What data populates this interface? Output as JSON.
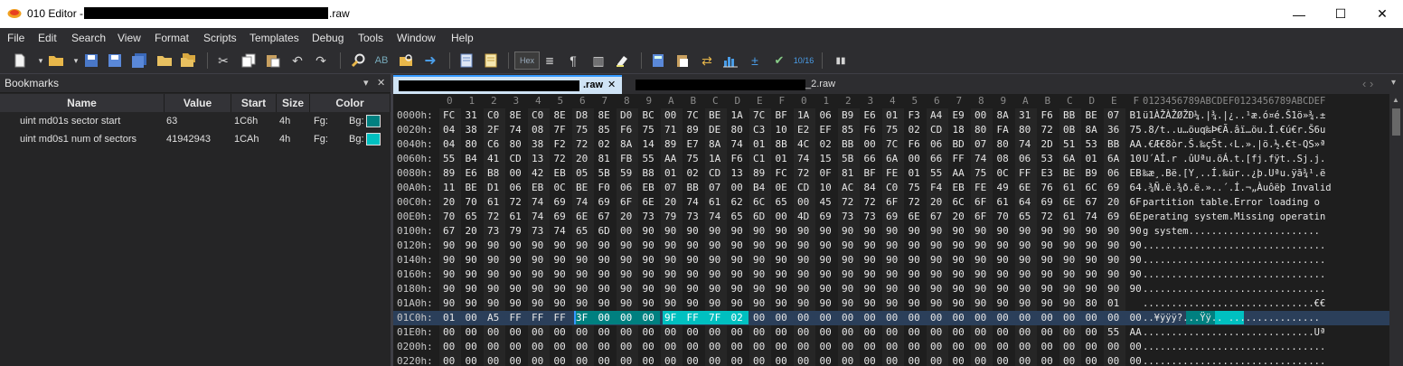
{
  "window": {
    "app_title": "010 Editor -",
    "file_suffix": ".raw",
    "min_symbol": "—",
    "max_symbol": "☐",
    "close_symbol": "✕"
  },
  "menu": [
    "File",
    "Edit",
    "Search",
    "View",
    "Format",
    "Scripts",
    "Templates",
    "Debug",
    "Tools",
    "Window",
    "Help"
  ],
  "toolbar": {
    "hex_label": "Hex",
    "icons": [
      "new-file-icon",
      "open-folder-icon",
      "save-icon",
      "save-as-icon",
      "save-all-icon",
      "open-folder-2-icon",
      "open-project-icon",
      "cut-icon",
      "copy-icon",
      "paste-icon",
      "undo-icon",
      "redo-icon",
      "find-icon",
      "replace-icon",
      "find-in-files-icon",
      "goto-icon",
      "run-script-icon",
      "run-template-icon",
      "hex-mode-icon",
      "text-mode-icon",
      "paragraph-icon",
      "columns-icon",
      "highlight-icon",
      "calculator-icon",
      "clipboard-icon",
      "compare-icon",
      "histogram-icon",
      "plus-minus-icon",
      "checksum-icon",
      "base-convert-icon",
      "pause-icon"
    ]
  },
  "bookmarks": {
    "title": "Bookmarks",
    "pin_symbol": "▾",
    "close_symbol": "✕",
    "columns": [
      "Name",
      "Value",
      "Start",
      "Size",
      "Color"
    ],
    "rows": [
      {
        "name": "uint md01s sector start",
        "value": "63",
        "start": "1C6h",
        "size": "4h",
        "fg": "Fg:",
        "bg": "Bg:",
        "bg_color": "#008080"
      },
      {
        "name": "uint md0s1 num of sectors",
        "value": "41942943",
        "start": "1CAh",
        "size": "4h",
        "fg": "Fg:",
        "bg": "Bg:",
        "bg_color": "#00c0c0"
      }
    ]
  },
  "tabs": [
    {
      "suffix": ".raw",
      "close": "✕",
      "active": true
    },
    {
      "suffix": "_2.raw",
      "active": false
    }
  ],
  "nav_arrows": "‹  ›",
  "hex": {
    "col_header": [
      "0",
      "1",
      "2",
      "3",
      "4",
      "5",
      "6",
      "7",
      "8",
      "9",
      "A",
      "B",
      "C",
      "D",
      "E",
      "F",
      "0",
      "1",
      "2",
      "3",
      "4",
      "5",
      "6",
      "7",
      "8",
      "9",
      "A",
      "B",
      "C",
      "D",
      "E",
      "F"
    ],
    "ascii_header": "0123456789ABCDEF0123456789ABCDEF",
    "rows": [
      {
        "addr": "0000h:",
        "bytes": "FC 31 C0 8E C0 8E D8 8E D0 BC 00 7C BE 1A 7C BF 1A 06 B9 E6 01 F3 A4 E9 00 8A 31 F6 BB BE 07 B1",
        "ascii": "ü1ÀŽÀŽØŽÐ¼.|¾.|¿..¹æ.ó¤é.Š1ö»¾.±"
      },
      {
        "addr": "0020h:",
        "bytes": "04 38 2F 74 08 7F 75 85 F6 75 71 89 DE 80 C3 10 E2 EF 85 F6 75 02 CD 18 80 FA 80 72 0B 8A 36 75",
        "ascii": ".8/t..u…öuq‰Þ€Ã.âï…öu.Í.€ú€r.Š6u"
      },
      {
        "addr": "0040h:",
        "bytes": "04 80 C6 80 38 F2 72 02 8A 14 89 E7 8A 74 01 8B 4C 02 BB 00 7C F6 06 BD 07 80 74 2D 51 53 BB AA",
        "ascii": ".€Æ€8òr.Š.‰çŠt.‹L.».|ö.½.€t-QS»ª"
      },
      {
        "addr": "0060h:",
        "bytes": "55 B4 41 CD 13 72 20 81 FB 55 AA 75 1A F6 C1 01 74 15 5B 66 6A 00 66 FF 74 08 06 53 6A 01 6A 10",
        "ascii": "U´AÍ.r .ûUªu.öÁ.t.[fj.fÿt..Sj.j."
      },
      {
        "addr": "0080h:",
        "bytes": "89 E6 B8 00 42 EB 05 5B 59 B8 01 02 CD 13 89 FC 72 0F 81 BF FE 01 55 AA 75 0C FF E3 BE B9 06 EB",
        "ascii": "‰æ¸.Bë.[Y¸..Í.‰ür..¿þ.Uªu.ÿã¾¹.ë"
      },
      {
        "addr": "00A0h:",
        "bytes": "11 BE D1 06 EB 0C BE F0 06 EB 07 BB 07 00 B4 0E CD 10 AC 84 C0 75 F4 EB FE 49 6E 76 61 6C 69 64",
        "ascii": ".¾Ñ.ë.¾ð.ë.»..´.Í.¬„Àuôëþ Invalid"
      },
      {
        "addr": "00C0h:",
        "bytes": "20 70 61 72 74 69 74 69 6F 6E 20 74 61 62 6C 65 00 45 72 72 6F 72 20 6C 6F 61 64 69 6E 67 20 6F",
        "ascii": " partition table.Error loading o"
      },
      {
        "addr": "00E0h:",
        "bytes": "70 65 72 61 74 69 6E 67 20 73 79 73 74 65 6D 00 4D 69 73 73 69 6E 67 20 6F 70 65 72 61 74 69 6E",
        "ascii": "perating system.Missing operatin"
      },
      {
        "addr": "0100h:",
        "bytes": "67 20 73 79 73 74 65 6D 00 90 90 90 90 90 90 90 90 90 90 90 90 90 90 90 90 90 90 90 90 90 90 90",
        "ascii": "g system......................."
      },
      {
        "addr": "0120h:",
        "bytes": "90 90 90 90 90 90 90 90 90 90 90 90 90 90 90 90 90 90 90 90 90 90 90 90 90 90 90 90 90 90 90 90",
        "ascii": "................................"
      },
      {
        "addr": "0140h:",
        "bytes": "90 90 90 90 90 90 90 90 90 90 90 90 90 90 90 90 90 90 90 90 90 90 90 90 90 90 90 90 90 90 90 90",
        "ascii": "................................"
      },
      {
        "addr": "0160h:",
        "bytes": "90 90 90 90 90 90 90 90 90 90 90 90 90 90 90 90 90 90 90 90 90 90 90 90 90 90 90 90 90 90 90 90",
        "ascii": "................................"
      },
      {
        "addr": "0180h:",
        "bytes": "90 90 90 90 90 90 90 90 90 90 90 90 90 90 90 90 90 90 90 90 90 90 90 90 90 90 90 90 90 90 90 90",
        "ascii": "................................"
      },
      {
        "addr": "01A0h:",
        "bytes": "90 90 90 90 90 90 90 90 90 90 90 90 90 90 90 90 90 90 90 90 90 90 90 90 90 90 90 90 90 80 01",
        "ascii": "..............................€€"
      },
      {
        "addr": "01C0h:",
        "bytes": "01 00 A5 FF FF FF 3F 00 00 00 9F FF 7F 02 00 00 00 00 00 00 00 00 00 00 00 00 00 00 00 00 00 00",
        "ascii": "..¥ÿÿÿ?...Ÿÿ.. ................"
      },
      {
        "addr": "01E0h:",
        "bytes": "00 00 00 00 00 00 00 00 00 00 00 00 00 00 00 00 00 00 00 00 00 00 00 00 00 00 00 00 00 00 55 AA",
        "ascii": "..............................Uª"
      },
      {
        "addr": "0200h:",
        "bytes": "00 00 00 00 00 00 00 00 00 00 00 00 00 00 00 00 00 00 00 00 00 00 00 00 00 00 00 00 00 00 00 00",
        "ascii": "................................"
      },
      {
        "addr": "0220h:",
        "bytes": "00 00 00 00 00 00 00 00 00 00 00 00 00 00 00 00 00 00 00 00 00 00 00 00 00 00 00 00 00 00 00 00",
        "ascii": "................................"
      },
      {
        "addr": "0240h:",
        "bytes": "00 00 00 00 00 00 00 00 00 00 00 00 00 00 00 00 00 00 00 00 00 00 00 00 00 00 00 00 00 00 00 00",
        "ascii": "................................"
      }
    ],
    "colors": {
      "bm1": "#008080",
      "bm2": "#00c0c0",
      "cursor": "#3399ff"
    }
  }
}
